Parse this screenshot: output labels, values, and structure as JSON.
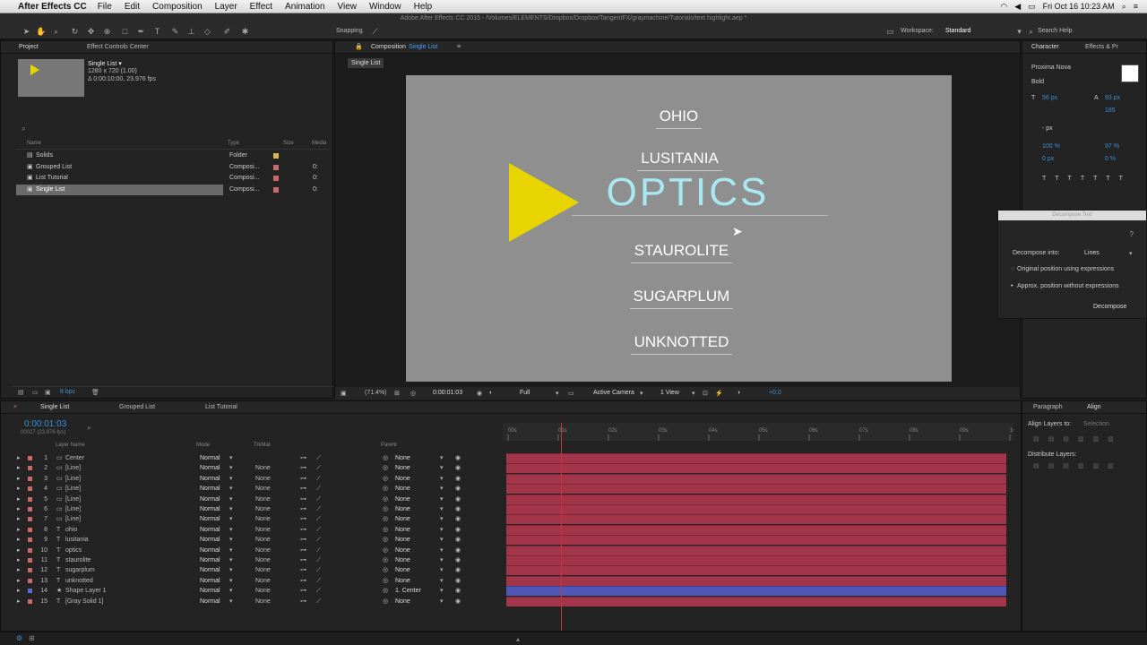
{
  "menubar": {
    "app": "After Effects CC",
    "items": [
      "File",
      "Edit",
      "Composition",
      "Layer",
      "Effect",
      "Animation",
      "View",
      "Window",
      "Help"
    ],
    "clock": "Fri Oct 16  10:23 AM"
  },
  "window_title": "Adobe After Effects CC 2015 - /Volumes/ELEMENTS/Dropbox/Dropbox/TangentFX/graymachine/Tutorials/text highlight.aep *",
  "toolbar": {
    "snapping": "Snapping",
    "workspace_label": "Workspace:",
    "workspace": "Standard",
    "search": "Search Help"
  },
  "project": {
    "tab": "Project",
    "tab2": "Effect Controls Center",
    "comp_name": "Single List ▾",
    "comp_size": "1280 x 720 (1.00)",
    "comp_dur": "Δ 0:00:10:00, 23.976 fps",
    "columns": [
      "Name",
      "Type",
      "Size",
      "Media"
    ],
    "items": [
      {
        "name": "Solids",
        "type": "Folder",
        "size": "",
        "sel": false
      },
      {
        "name": "Grouped List",
        "type": "Composi...",
        "size": "0:",
        "sel": false
      },
      {
        "name": "List Tutorial",
        "type": "Composi...",
        "size": "0:",
        "sel": false
      },
      {
        "name": "Single List",
        "type": "Composi...",
        "size": "0:",
        "sel": true
      }
    ],
    "bpc": "8 bpc"
  },
  "comp": {
    "tab": "Composition",
    "tab_comp": "Single List",
    "subtab": "Single List",
    "words": [
      "OHIO",
      "LUSITANIA",
      "OPTICS",
      "STAUROLITE",
      "SUGARPLUM",
      "UNKNOTTED"
    ],
    "footer": {
      "zoom": "(71.4%)",
      "time": "0:00:01:03",
      "res": "Full",
      "camera": "Active Camera",
      "view": "1 View",
      "exposure": "+0.0"
    }
  },
  "character": {
    "tab": "Character",
    "tab2": "Effects & Pr",
    "font": "Proxima Nova",
    "style": "Bold",
    "size": "56 px",
    "leading": "93 px",
    "tracking": "185",
    "stroke": "- px",
    "vscale": "100 %",
    "hscale": "97 %",
    "baseline": "0 px",
    "tsume": "0 %"
  },
  "decompose": {
    "title": "Decompose Text",
    "into_label": "Decompose into:",
    "into": "Lines",
    "opt1": "Original position using expressions",
    "opt2": "Approx. position without expressions",
    "button": "Decompose"
  },
  "timeline": {
    "tabs": [
      "Single List",
      "Grouped List",
      "List Tutorial"
    ],
    "timecode": "0:00:01:03",
    "frames": "00027 (23.976 fps)",
    "headers": {
      "layer": "Layer Name",
      "mode": "Mode",
      "trk": "TrkMat",
      "parent": "Parent"
    },
    "ruler": [
      "00s",
      "01s",
      "02s",
      "03s",
      "04s",
      "05s",
      "06s",
      "07s",
      "08s",
      "09s",
      "10"
    ],
    "layers": [
      {
        "n": "1",
        "name": "Center",
        "mode": "Normal",
        "trk": "",
        "parent": "None"
      },
      {
        "n": "2",
        "name": "[Line]",
        "mode": "Normal",
        "trk": "None",
        "parent": "None"
      },
      {
        "n": "3",
        "name": "[Line]",
        "mode": "Normal",
        "trk": "None",
        "parent": "None"
      },
      {
        "n": "4",
        "name": "[Line]",
        "mode": "Normal",
        "trk": "None",
        "parent": "None"
      },
      {
        "n": "5",
        "name": "[Line]",
        "mode": "Normal",
        "trk": "None",
        "parent": "None"
      },
      {
        "n": "6",
        "name": "[Line]",
        "mode": "Normal",
        "trk": "None",
        "parent": "None"
      },
      {
        "n": "7",
        "name": "[Line]",
        "mode": "Normal",
        "trk": "None",
        "parent": "None"
      },
      {
        "n": "8",
        "name": "ohio",
        "mode": "Normal",
        "trk": "None",
        "parent": "None"
      },
      {
        "n": "9",
        "name": "lusitania",
        "mode": "Normal",
        "trk": "None",
        "parent": "None"
      },
      {
        "n": "10",
        "name": "optics",
        "mode": "Normal",
        "trk": "None",
        "parent": "None"
      },
      {
        "n": "11",
        "name": "staurolite",
        "mode": "Normal",
        "trk": "None",
        "parent": "None"
      },
      {
        "n": "12",
        "name": "sugarplum",
        "mode": "Normal",
        "trk": "None",
        "parent": "None"
      },
      {
        "n": "13",
        "name": "unknotted",
        "mode": "Normal",
        "trk": "None",
        "parent": "None"
      },
      {
        "n": "14",
        "name": "Shape Layer 1",
        "mode": "Normal",
        "trk": "None",
        "parent": "1. Center"
      },
      {
        "n": "15",
        "name": "[Gray Solid 1]",
        "mode": "Normal",
        "trk": "None",
        "parent": "None"
      }
    ]
  },
  "align": {
    "tab1": "Paragraph",
    "tab2": "Align",
    "align_to_label": "Align Layers to:",
    "align_to": "Selection",
    "distribute": "Distribute Layers:"
  },
  "colors": {
    "accent": "#3a8fd6",
    "layer_bar": "#a3354a",
    "shape_bar": "#4e57b8",
    "triangle": "#e8d400",
    "optics": "#a8e8f0"
  }
}
